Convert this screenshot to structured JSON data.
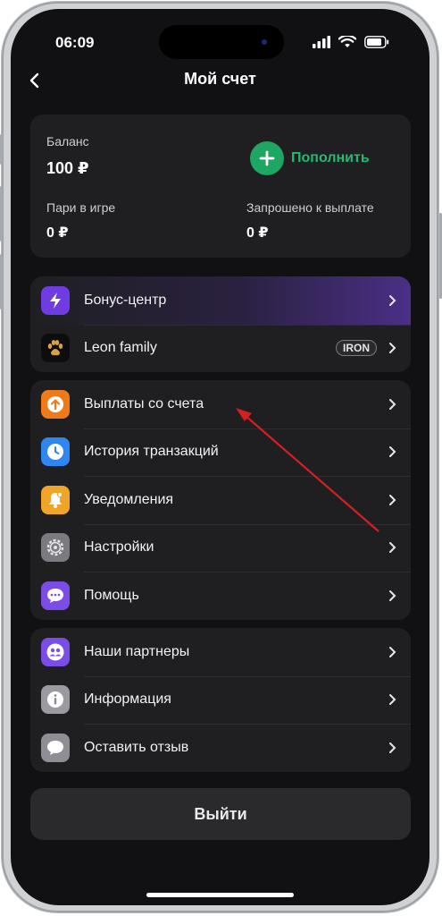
{
  "status": {
    "time": "06:09"
  },
  "header": {
    "title": "Мой счет"
  },
  "balance": {
    "label": "Баланс",
    "value": "100 ₽",
    "topup_label": "Пополнить",
    "bets_label": "Пари в игре",
    "bets_value": "0 ₽",
    "withdraw_label": "Запрошено к выплате",
    "withdraw_value": "0 ₽"
  },
  "group1": [
    {
      "label": "Бонус-центр",
      "icon": "lightning-icon"
    },
    {
      "label": "Leon family",
      "icon": "paw-icon",
      "badge": "IRON"
    }
  ],
  "group2": [
    {
      "label": "Выплаты со счета",
      "icon": "arrow-up-circle-icon"
    },
    {
      "label": "История транзакций",
      "icon": "clock-icon"
    },
    {
      "label": "Уведомления",
      "icon": "bell-icon"
    },
    {
      "label": "Настройки",
      "icon": "gear-icon"
    },
    {
      "label": "Помощь",
      "icon": "chat-bubble-icon"
    }
  ],
  "group3": [
    {
      "label": "Наши партнеры",
      "icon": "people-icon"
    },
    {
      "label": "Информация",
      "icon": "info-icon"
    },
    {
      "label": "Оставить отзыв",
      "icon": "speech-bubble-icon"
    }
  ],
  "logout": {
    "label": "Выйти"
  },
  "colors": {
    "accent_green": "#1fa662",
    "background": "#111113",
    "card": "#1f1f22",
    "annotation_arrow": "#d42020"
  }
}
